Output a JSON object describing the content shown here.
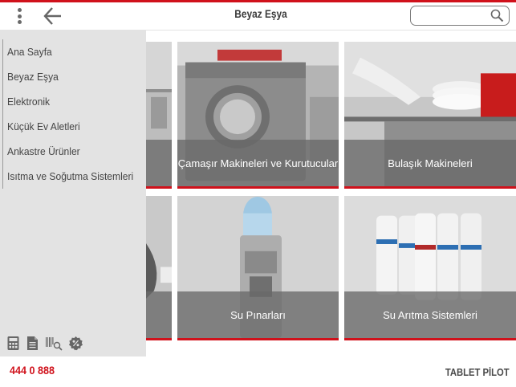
{
  "header": {
    "title": "Beyaz Eşya",
    "menu_icon": "vertical-dots-icon",
    "back_icon": "back-arrow-icon",
    "search": {
      "value": "",
      "placeholder": "",
      "icon": "search-icon"
    }
  },
  "sidebar": {
    "items": [
      {
        "label": "Ana Sayfa"
      },
      {
        "label": "Beyaz Eşya"
      },
      {
        "label": "Elektronik"
      },
      {
        "label": "Küçük Ev Aletleri"
      },
      {
        "label": "Ankastre Ürünler"
      },
      {
        "label": "Isıtma ve Soğutma Sistemleri"
      }
    ],
    "tools": [
      "calculator-icon",
      "document-icon",
      "barcode-search-icon",
      "discount-icon"
    ]
  },
  "tiles": [
    {
      "label": "ular"
    },
    {
      "label": "Çamaşır Makineleri ve Kurutucular"
    },
    {
      "label": "Bulaşık Makineleri"
    },
    {
      "label": ""
    },
    {
      "label": "Su Pınarları"
    },
    {
      "label": "Su Arıtma Sistemleri"
    }
  ],
  "footer": {
    "phone": "444 0 888",
    "brand": "TABLET PİLOT"
  },
  "colors": {
    "accent": "#d0111b",
    "drawer_bg": "#e3e3e3",
    "band_bg": "#696969"
  }
}
